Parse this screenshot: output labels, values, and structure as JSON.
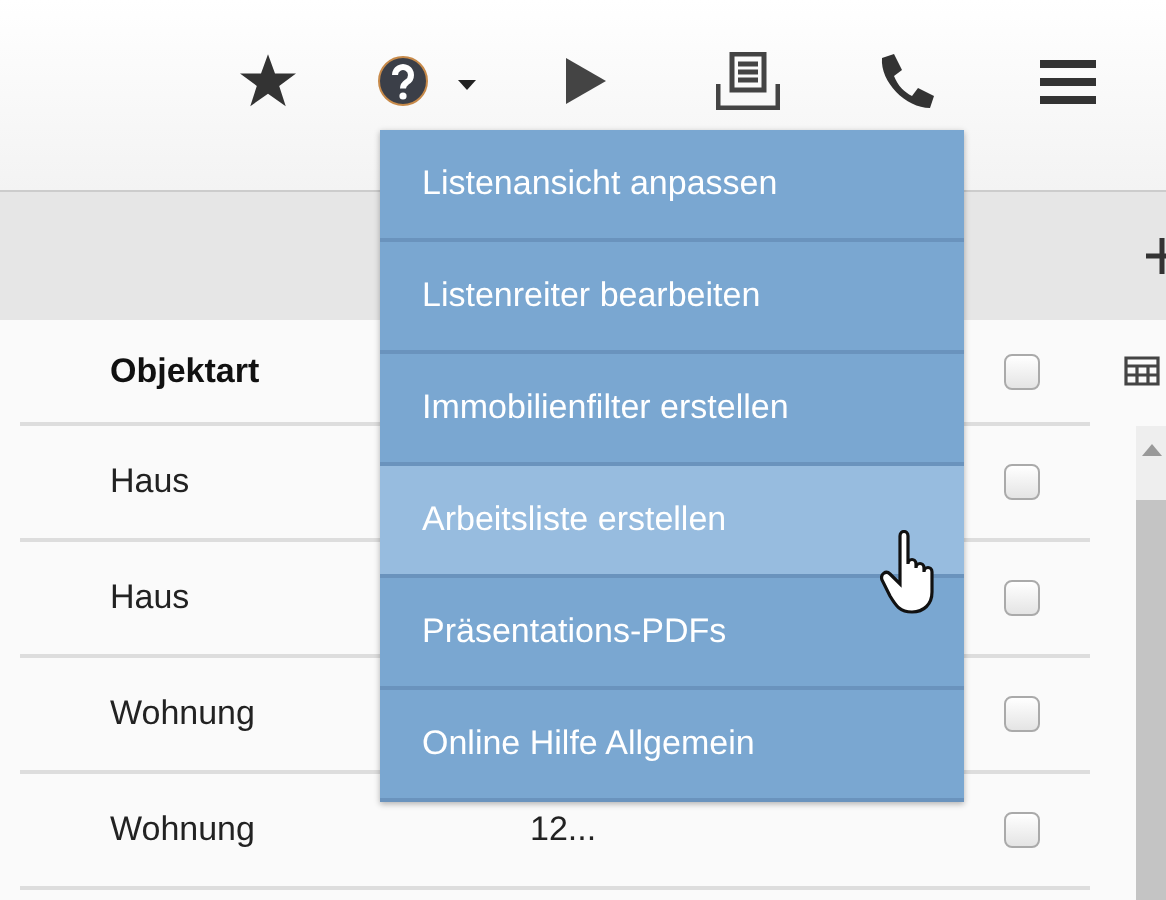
{
  "help_menu": {
    "items": [
      {
        "label": "Listenansicht anpassen",
        "hovered": false
      },
      {
        "label": "Listenreiter bearbeiten",
        "hovered": false
      },
      {
        "label": "Immobilienfilter erstellen",
        "hovered": false
      },
      {
        "label": "Arbeitsliste erstellen",
        "hovered": true
      },
      {
        "label": "Präsentations-PDFs",
        "hovered": false
      },
      {
        "label": "Online Hilfe Allgemein",
        "hovered": false
      }
    ]
  },
  "table": {
    "columns": [
      "Objektart"
    ],
    "header_checked": false,
    "rows": [
      {
        "objektart": "Haus",
        "checked": false
      },
      {
        "objektart": "Haus",
        "checked": false
      },
      {
        "objektart": "Wohnung",
        "checked": false
      },
      {
        "objektart": "Wohnung",
        "column_2": "12...",
        "checked": false
      }
    ]
  }
}
